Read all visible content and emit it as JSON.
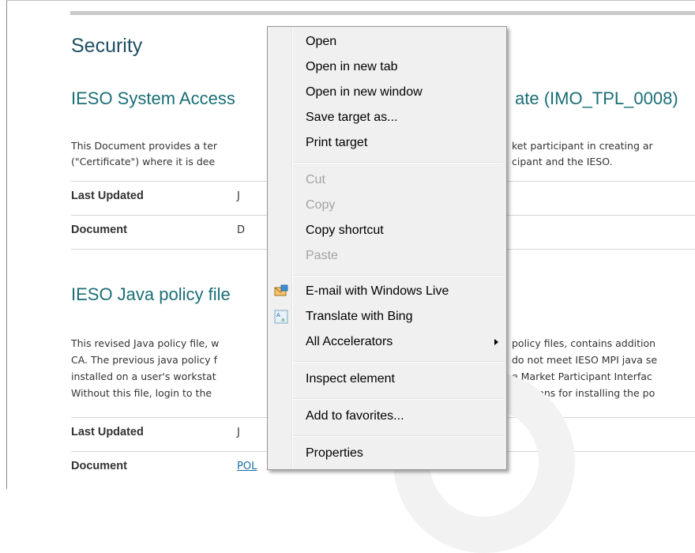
{
  "page": {
    "section_title": "Security",
    "doc1": {
      "title_left": "IESO System Access",
      "title_right": "ate (IMO_TPL_0008)",
      "para_lines_left": [
        "This Document provides a ter",
        "(\"Certificate\") where it is dee"
      ],
      "para_lines_right": [
        "ket participant in creating ar",
        "cipant and the IESO."
      ],
      "rows": [
        {
          "label": "Last Updated",
          "value": "J"
        },
        {
          "label": "Document",
          "value": "D"
        }
      ]
    },
    "doc2": {
      "title": "IESO Java policy file",
      "para_lines_left": [
        "This revised Java policy file, w",
        "CA. The previous java policy f",
        "installed on a user's workstat",
        "Without this file, login to the"
      ],
      "para_lines_right": [
        "policy files, contains addition",
        "do not meet IESO MPI java se",
        "e Market Participant Interfac",
        "tructions for installing the po"
      ],
      "rows": [
        {
          "label": "Last Updated",
          "value": "J"
        },
        {
          "label": "Document",
          "value": "POL"
        }
      ]
    }
  },
  "context_menu": {
    "items": {
      "open": "Open",
      "open_new_tab": "Open in new tab",
      "open_new_window": "Open in new window",
      "save_target": "Save target as...",
      "print_target": "Print target",
      "cut": "Cut",
      "copy": "Copy",
      "copy_shortcut": "Copy shortcut",
      "paste": "Paste",
      "email": "E-mail with Windows Live",
      "translate": "Translate with Bing",
      "accelerators": "All Accelerators",
      "inspect": "Inspect element",
      "favorites": "Add to favorites...",
      "properties": "Properties"
    },
    "icons": {
      "email": "email-windows-live-icon",
      "translate": "bing-translate-icon",
      "submenu": "submenu-arrow-icon"
    }
  },
  "colors": {
    "heading": "#1f4e64",
    "doc_title": "#1b6e76",
    "link": "#1a6fa8",
    "menu_bg": "#f0f0f0",
    "disabled": "#a3a3a3"
  }
}
